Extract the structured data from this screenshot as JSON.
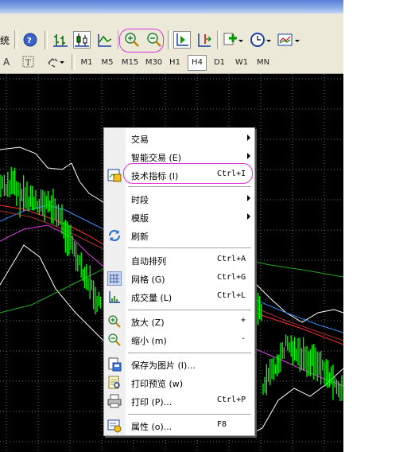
{
  "toolbar": {
    "cut_text": "统",
    "timeframes": [
      "M1",
      "M5",
      "M15",
      "M30",
      "H1",
      "H4",
      "D1",
      "W1",
      "MN"
    ],
    "selected_timeframe": "H4",
    "font_letter": "A"
  },
  "menu": {
    "items": [
      {
        "label": "交易",
        "shortcut": "",
        "submenu": true,
        "icon": ""
      },
      {
        "label": "智能交易 (E)",
        "shortcut": "",
        "submenu": true,
        "icon": ""
      },
      {
        "label": "技术指标 (I)",
        "shortcut": "Ctrl+I",
        "submenu": false,
        "icon": "indicator-icon"
      },
      {
        "label": "时段",
        "shortcut": "",
        "submenu": true,
        "icon": ""
      },
      {
        "label": "模版",
        "shortcut": "",
        "submenu": true,
        "icon": ""
      },
      {
        "label": "刷新",
        "shortcut": "",
        "submenu": false,
        "icon": "refresh-icon"
      },
      {
        "label": "自动排列",
        "shortcut": "Ctrl+A",
        "submenu": false,
        "icon": ""
      },
      {
        "label": "网格 (G)",
        "shortcut": "Ctrl+G",
        "submenu": false,
        "icon": "grid-icon"
      },
      {
        "label": "成交量 (L)",
        "shortcut": "Ctrl+L",
        "submenu": false,
        "icon": "volume-icon"
      },
      {
        "label": "放大 (Z)",
        "shortcut": "+",
        "submenu": false,
        "icon": "zoom-in-icon"
      },
      {
        "label": "缩小 (m)",
        "shortcut": "-",
        "submenu": false,
        "icon": "zoom-out-icon"
      },
      {
        "label": "保存为图片 (I)...",
        "shortcut": "",
        "submenu": false,
        "icon": "save-image-icon"
      },
      {
        "label": "打印预览 (w)",
        "shortcut": "",
        "submenu": false,
        "icon": "print-preview-icon"
      },
      {
        "label": "打印 (P)...",
        "shortcut": "Ctrl+P",
        "submenu": false,
        "icon": "print-icon"
      },
      {
        "label": "属性 (o)...",
        "shortcut": "F8",
        "submenu": false,
        "icon": "properties-icon"
      }
    ]
  },
  "colors": {
    "chart_bg": "#000000",
    "grid": "#6b6b6b",
    "candles": "#00ff00",
    "bollinger": "#ffffff",
    "highlight": "#e030e0",
    "toolbar": "#ece9d8"
  }
}
